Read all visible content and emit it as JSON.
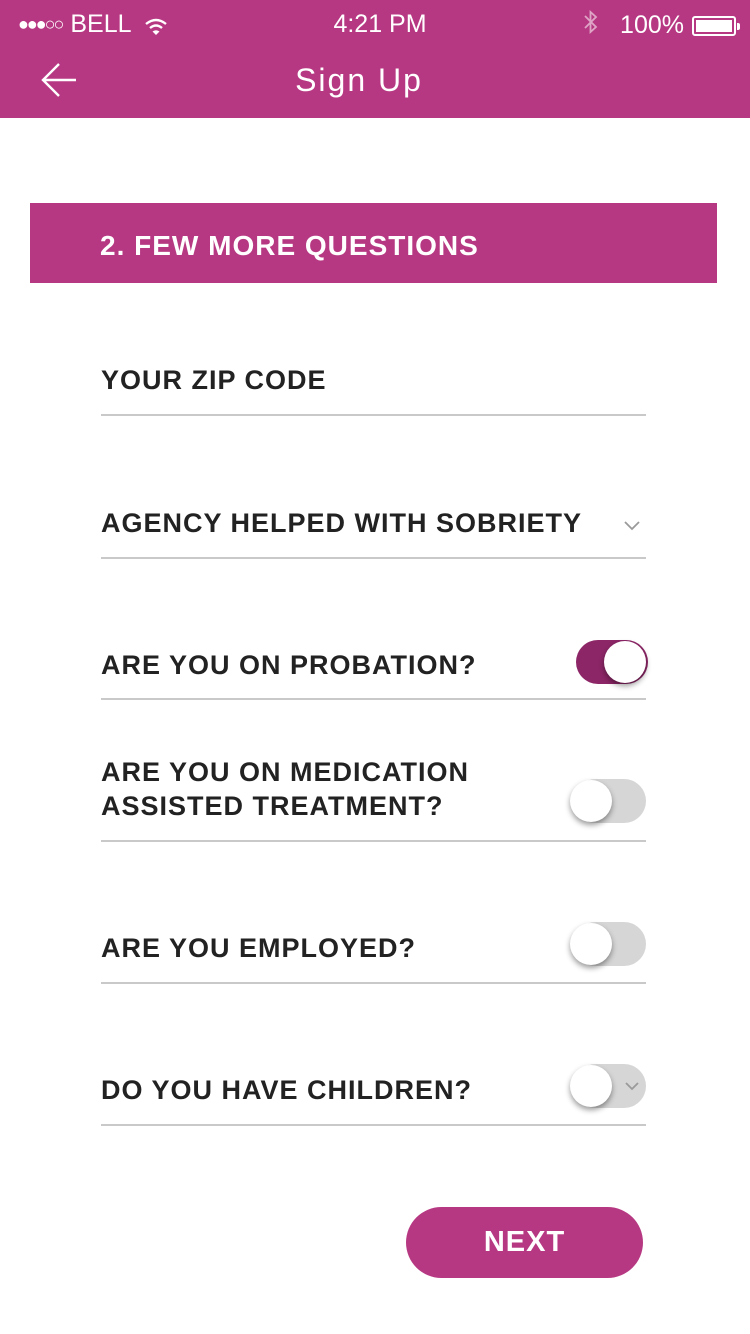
{
  "status_bar": {
    "signal": "●●●○○",
    "carrier": "BELL",
    "time": "4:21 PM",
    "bluetooth_glyph": "∗",
    "battery_percent": "100%",
    "battery_level": 1.0
  },
  "header": {
    "title": "Sign Up",
    "back_icon": "arrow-left-icon"
  },
  "section": {
    "title": "2. FEW MORE QUESTIONS"
  },
  "form": {
    "zip_code": {
      "label": "YOUR ZIP CODE",
      "value": ""
    },
    "agency": {
      "label": "AGENCY HELPED WITH SOBRIETY",
      "icon": "chevron-down-icon"
    },
    "probation": {
      "label": "ARE YOU ON PROBATION?",
      "on": true
    },
    "medication": {
      "label_line1": "ARE YOU ON MEDICATION",
      "label_line2": "ASSISTED TREATMENT?",
      "on": false
    },
    "employed": {
      "label": "ARE YOU EMPLOYED?",
      "on": false
    },
    "children": {
      "label": "DO YOU HAVE CHILDREN?",
      "on": false
    }
  },
  "next_button": {
    "label": "NEXT"
  },
  "colors": {
    "brand": "#b73882",
    "toggle_on": "#8d2667",
    "toggle_off": "#d6d6d6",
    "divider": "#c9c9c9"
  }
}
